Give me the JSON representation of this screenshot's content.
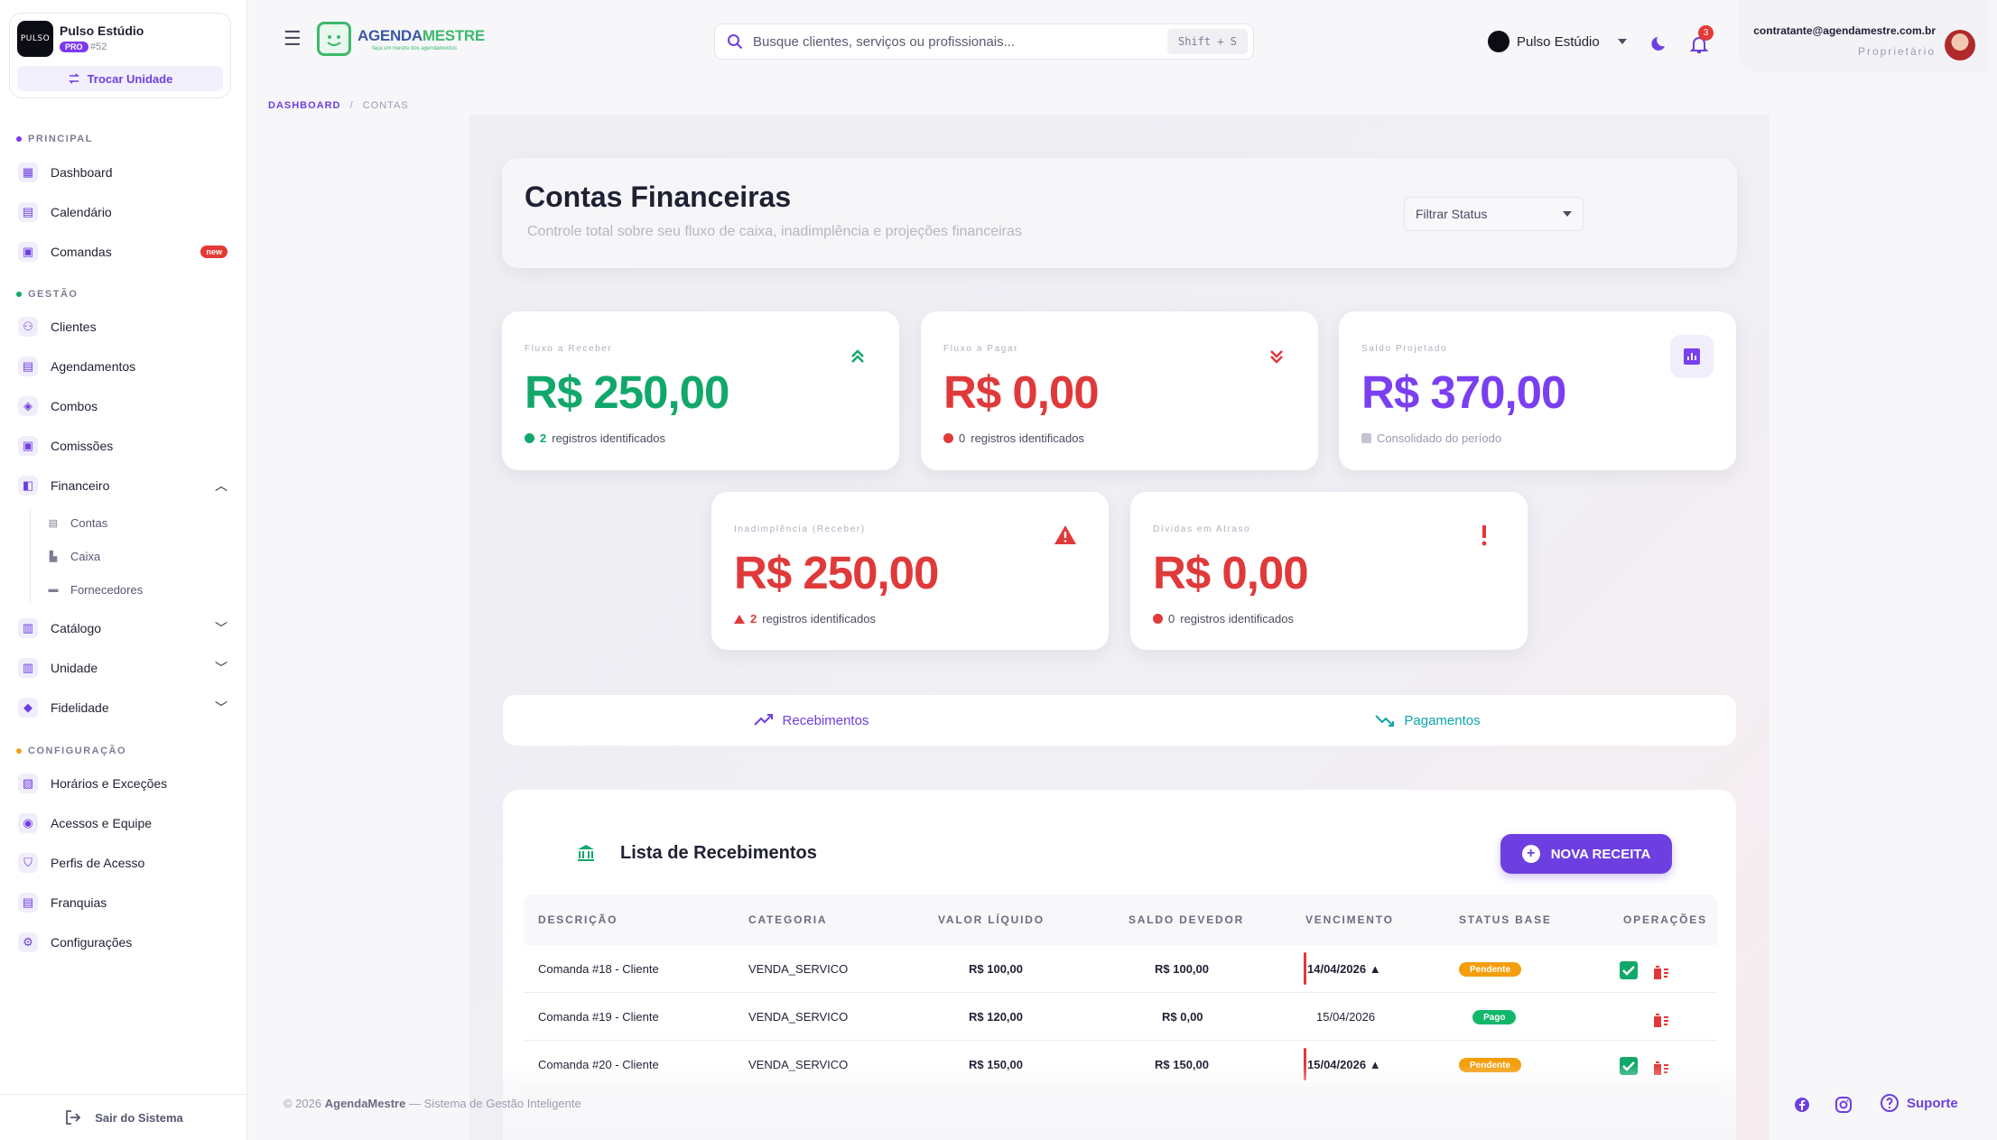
{
  "sidebar": {
    "unit": {
      "logo_text": "PULSO",
      "name": "Pulso Estúdio",
      "plan": "PRO",
      "number": "#52",
      "switch_label": "Trocar Unidade"
    },
    "sections": [
      {
        "label": "PRINCIPAL",
        "color": "#7c3aed"
      },
      {
        "label": "GESTÃO",
        "color": "#12a86b"
      },
      {
        "label": "CONFIGURAÇÃO",
        "color": "#f0a020"
      }
    ],
    "items": {
      "dashboard": "Dashboard",
      "calendario": "Calendário",
      "comandas": "Comandas",
      "comandas_badge": "new",
      "clientes": "Clientes",
      "agendamentos": "Agendamentos",
      "combos": "Combos",
      "comissoes": "Comissões",
      "financeiro": "Financeiro",
      "contas": "Contas",
      "caixa": "Caixa",
      "fornecedores": "Fornecedores",
      "catalogo": "Catálogo",
      "unidade": "Unidade",
      "fidelidade": "Fidelidade",
      "horarios": "Horários e Exceções",
      "acessos": "Acessos e Equipe",
      "perfis": "Perfis de Acesso",
      "franquias": "Franquias",
      "configuracoes": "Configurações"
    },
    "logout": "Sair do Sistema"
  },
  "header": {
    "logo_main": "AGENDA",
    "logo_accent": "MESTRE",
    "logo_tagline": "faça um mestre dos agendamentos",
    "search_placeholder": "Busque clientes, serviços ou profissionais...",
    "search_shortcut": "Shift + S",
    "unit_selector": "Pulso Estúdio",
    "notifications": "3",
    "user_email": "contratante@agendamestre.com.br",
    "user_role": "Proprietário"
  },
  "breadcrumb": {
    "root": "DASHBOARD",
    "separator": "/",
    "current": "CONTAS"
  },
  "hero": {
    "title": "Contas Financeiras",
    "subtitle": "Controle total sobre seu fluxo de caixa, inadimplência e projeções financeiras",
    "filter_label": "Filtrar Status"
  },
  "cards": {
    "receber": {
      "label": "Fluxo a Receber",
      "value": "R$ 250,00",
      "count": "2",
      "foot": "registros identificados"
    },
    "pagar": {
      "label": "Fluxo a Pagar",
      "value": "R$ 0,00",
      "count": "0",
      "foot": "registros identificados"
    },
    "saldo": {
      "label": "Saldo Projetado",
      "value": "R$ 370,00",
      "foot": "Consolidado do período"
    },
    "inadimplencia": {
      "label": "Inadimplência (Receber)",
      "value": "R$ 250,00",
      "count": "2",
      "foot": "registros identificados"
    },
    "dividas": {
      "label": "Dívidas em Atraso",
      "value": "R$ 0,00",
      "count": "0",
      "foot": "registros identificados"
    }
  },
  "colors": {
    "green": "#12a86b",
    "red": "#e0393a",
    "purple": "#7a3ff0",
    "accent": "#6d3fe0",
    "pending": "#f59e0b",
    "paid": "#12b76a"
  },
  "tabs": [
    {
      "label": "Recebimentos",
      "icon": "trending-up-icon"
    },
    {
      "label": "Pagamentos",
      "icon": "trending-down-icon"
    }
  ],
  "list": {
    "title": "Lista de Recebimentos",
    "new_button": "NOVA RECEITA",
    "columns": [
      "DESCRIÇÃO",
      "CATEGORIA",
      "VALOR LÍQUIDO",
      "SALDO DEVEDOR",
      "VENCIMENTO",
      "STATUS BASE",
      "OPERAÇÕES"
    ],
    "rows": [
      {
        "descricao": "Comanda #18 - Cliente",
        "categoria": "VENDA_SERVICO",
        "valor": "R$ 100,00",
        "saldo": "R$ 100,00",
        "vencimento": "14/04/2026",
        "overdue": true,
        "status": "Pendente"
      },
      {
        "descricao": "Comanda #19 - Cliente",
        "categoria": "VENDA_SERVICO",
        "valor": "R$ 120,00",
        "saldo": "R$ 0,00",
        "vencimento": "15/04/2026",
        "overdue": false,
        "status": "Pago"
      },
      {
        "descricao": "Comanda #20 - Cliente",
        "categoria": "VENDA_SERVICO",
        "valor": "R$ 150,00",
        "saldo": "R$ 150,00",
        "vencimento": "15/04/2026",
        "overdue": true,
        "status": "Pendente"
      }
    ]
  },
  "footer": {
    "copyright_prefix": "© 2026",
    "brand": "AgendaMestre",
    "copyright_suffix": "— Sistema de Gestão Inteligente",
    "support": "Suporte"
  }
}
